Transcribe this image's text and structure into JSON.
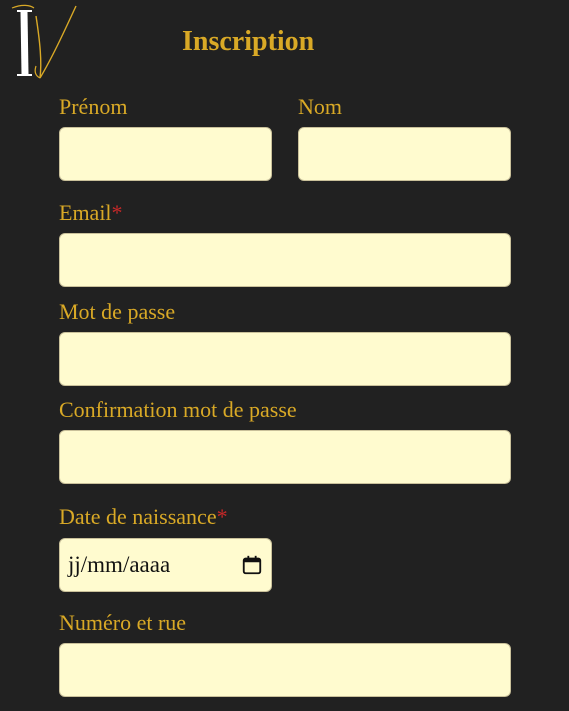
{
  "header": {
    "title": "Inscription"
  },
  "form": {
    "prenom": {
      "label": "Prénom",
      "value": ""
    },
    "nom": {
      "label": "Nom",
      "value": ""
    },
    "email": {
      "label": "Email",
      "required_mark": "*",
      "value": ""
    },
    "password": {
      "label": "Mot de passe",
      "value": ""
    },
    "password_confirm": {
      "label": "Confirmation mot de passe",
      "value": ""
    },
    "birthdate": {
      "label": "Date de naissance",
      "required_mark": "*",
      "placeholder": "jj/mm/aaaa"
    },
    "street": {
      "label": "Numéro et rue",
      "value": ""
    }
  },
  "colors": {
    "background": "#212121",
    "accent": "#d9a926",
    "input_background": "#fffbcf",
    "required": "#c62828"
  },
  "icons": {
    "logo": "monogram-logo-icon",
    "date_picker": "calendar-icon"
  }
}
